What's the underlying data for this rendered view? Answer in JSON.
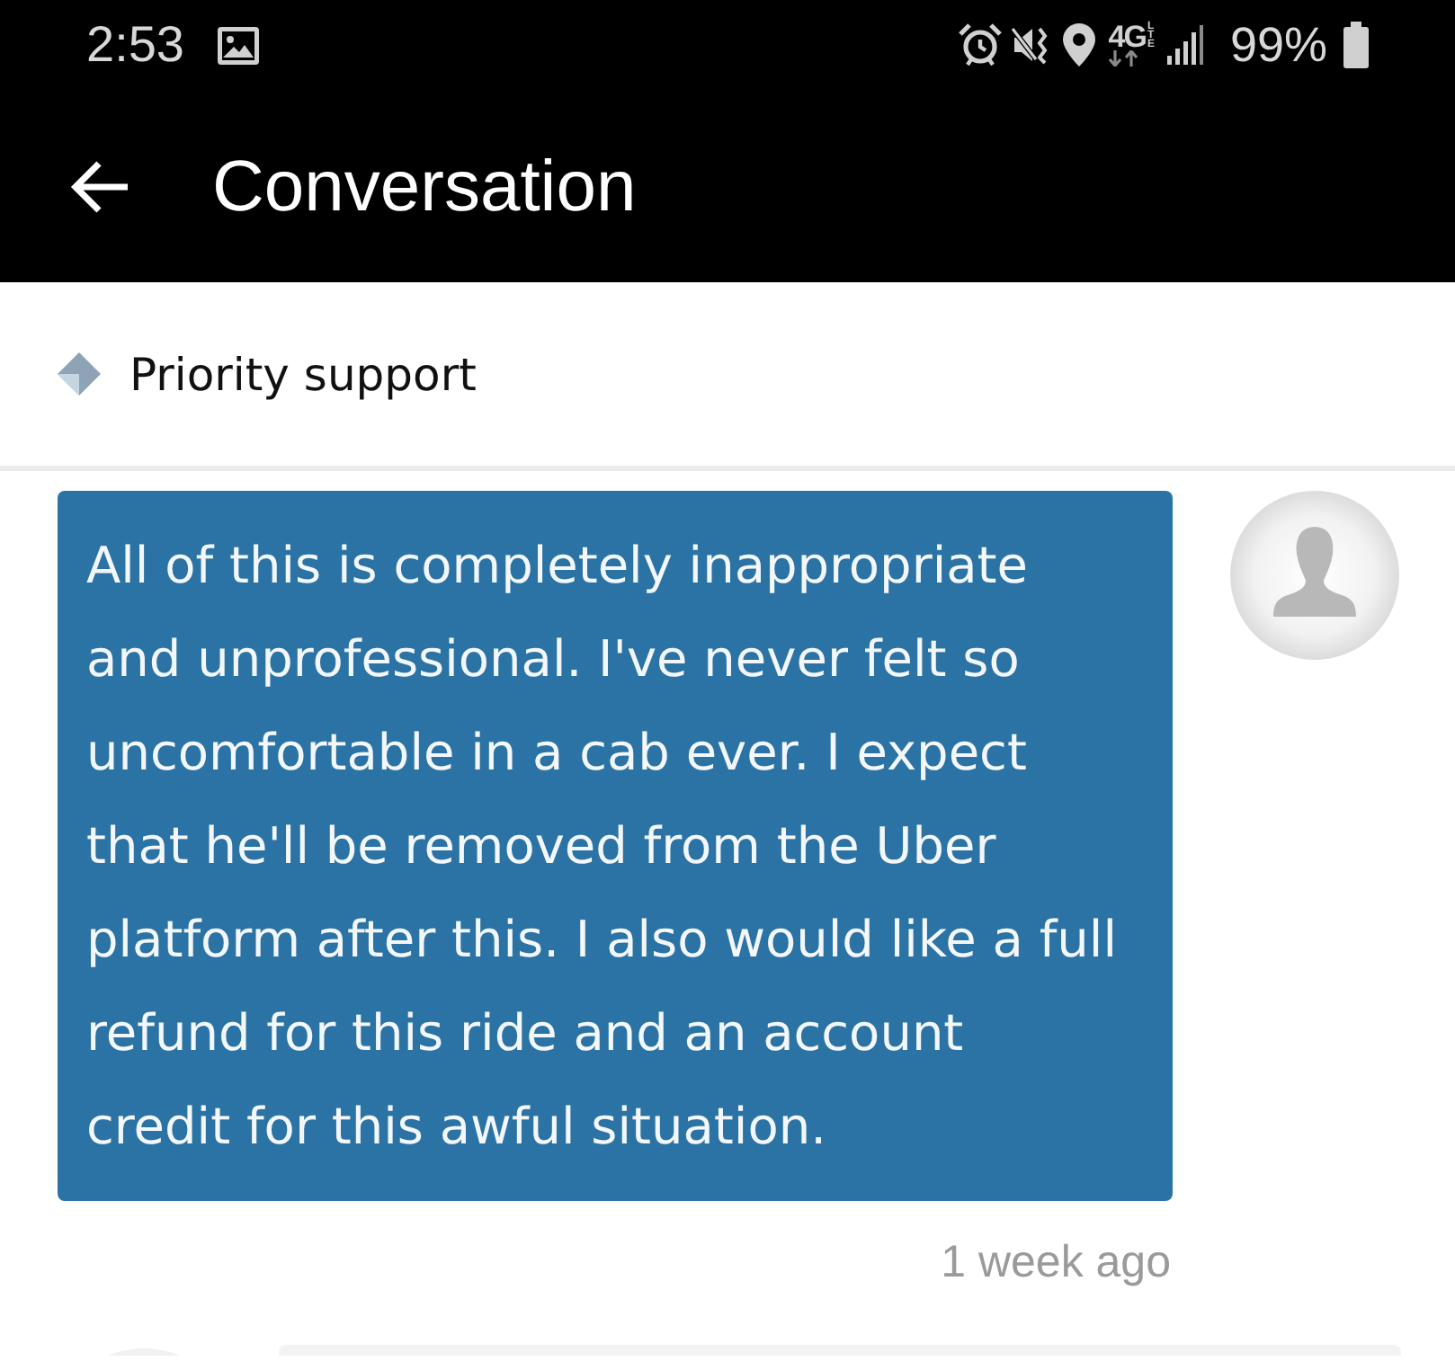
{
  "status_bar": {
    "time": "2:53",
    "network_type": "4G",
    "network_subtype": "LTE",
    "battery_percent": "99%"
  },
  "app_bar": {
    "title": "Conversation"
  },
  "support_header": {
    "label": "Priority support"
  },
  "messages": [
    {
      "kind": "outgoing",
      "text": "All of this is completely inappropriate and unprofessional. I've never felt so uncomfortable in a cab ever. I expect that he'll be removed from the Uber platform after this. I also would like a full refund for this ride and an account credit for this awful situation.",
      "time": "1 week ago"
    },
    {
      "kind": "incoming"
    }
  ]
}
